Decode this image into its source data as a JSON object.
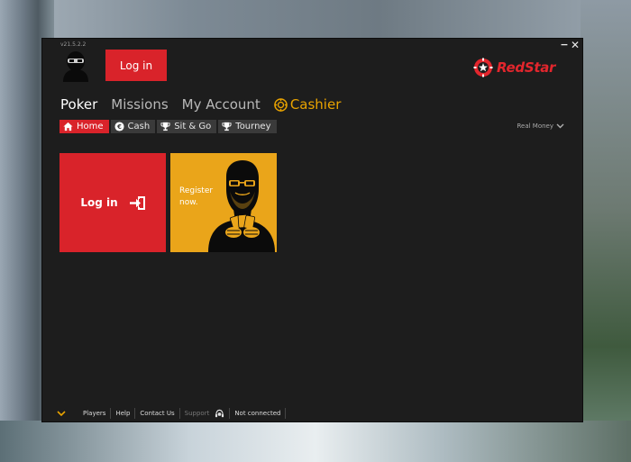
{
  "window": {
    "version": "v21.5.2.2",
    "minimize_glyph": "−",
    "close_glyph": "✕"
  },
  "header": {
    "login_label": "Log in",
    "logo_text": "RedStar"
  },
  "nav": {
    "items": [
      {
        "label": "Poker"
      },
      {
        "label": "Missions"
      },
      {
        "label": "My Account"
      },
      {
        "label": "Cashier"
      }
    ]
  },
  "subnav": {
    "tabs": [
      {
        "label": "Home",
        "icon": "home-icon"
      },
      {
        "label": "Cash",
        "icon": "chip-icon"
      },
      {
        "label": "Sit & Go",
        "icon": "trophy-icon"
      },
      {
        "label": "Tourney",
        "icon": "trophy-icon"
      }
    ],
    "mode_label": "Real Money"
  },
  "tiles": {
    "login_label": "Log in",
    "register_label": "Register now."
  },
  "footer": {
    "links": [
      {
        "label": "Players"
      },
      {
        "label": "Help"
      },
      {
        "label": "Contact Us"
      },
      {
        "label": "Support"
      }
    ],
    "status": "Not connected"
  },
  "colors": {
    "accent_red": "#d9232a",
    "cashier_gold": "#e9a300",
    "register_tile": "#eaa51a",
    "app_bg": "#1d1d1d"
  }
}
